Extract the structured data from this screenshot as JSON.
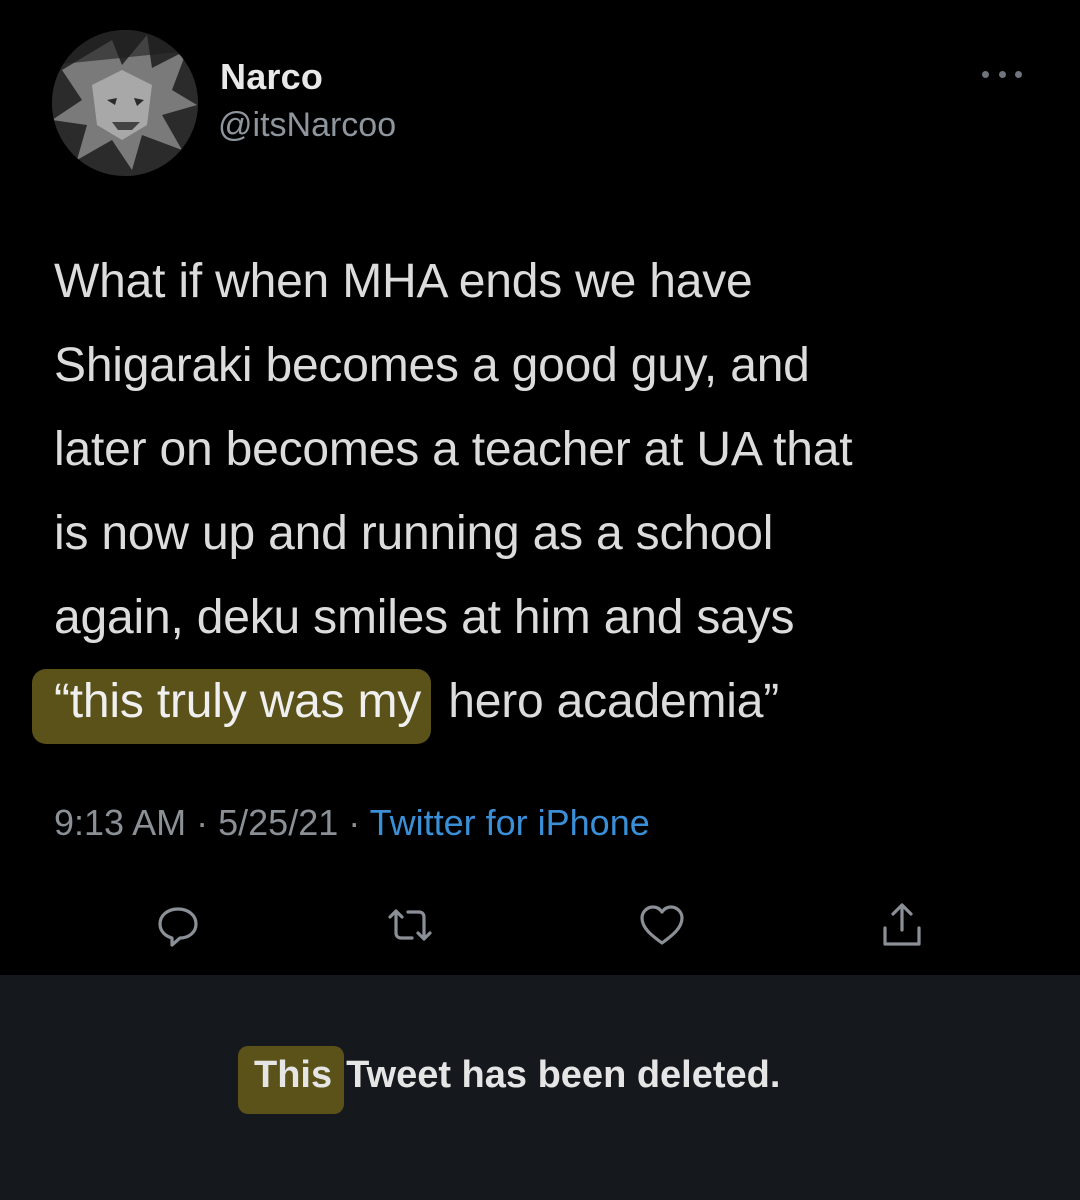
{
  "tweet": {
    "display_name": "Narco",
    "handle": "@itsNarcoo",
    "text_lines": [
      "What if when MHA ends we have",
      "Shigaraki becomes a good guy, and",
      "later on becomes a teacher at UA that",
      "is now up and running as a school",
      "again, deku smiles at him and says"
    ],
    "last_line_highlighted": "“this truly was my",
    "last_line_rest": "hero academia”",
    "time": "9:13 AM",
    "separator": "·",
    "date": "5/25/21",
    "source": "Twitter for iPhone"
  },
  "actions": [
    {
      "name": "reply-icon"
    },
    {
      "name": "retweet-icon"
    },
    {
      "name": "like-icon"
    },
    {
      "name": "share-icon"
    }
  ],
  "deleted_notice": {
    "highlighted": "This",
    "rest": "Tweet has been deleted."
  },
  "colors": {
    "background": "#000000",
    "deleted_bar": "#15181c",
    "highlight": "#5a5218",
    "link": "#3b8fd6",
    "muted": "#8a9096"
  }
}
